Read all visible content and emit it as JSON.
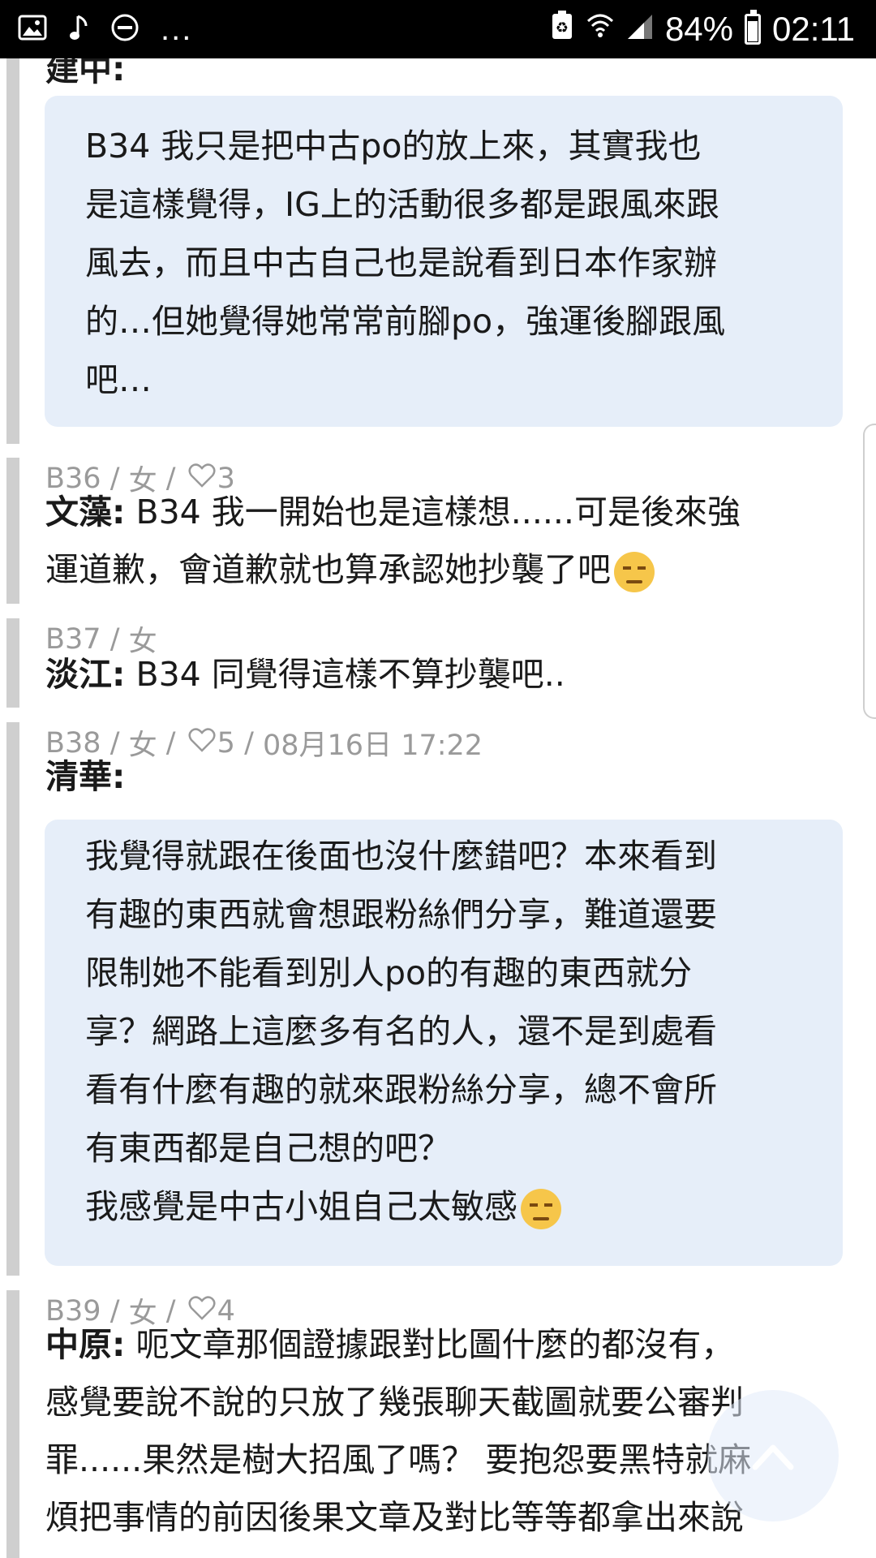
{
  "status_bar": {
    "left_icons": [
      "image-icon",
      "music-note-icon",
      "do-not-disturb-icon"
    ],
    "overflow": "...",
    "battery_percent": "84%",
    "time": "02:11"
  },
  "thread": {
    "c1": {
      "author_partial": "建中:",
      "quote_lines": [
        "B34 我只是把中古po的放上來，其實我也",
        "是這樣覺得，IG上的活動很多都是跟風來跟",
        "風去，而且中古自己也是說看到日本作家辦",
        "的…但她覺得她常常前腳po，強運後腳跟風",
        "吧…"
      ]
    },
    "c2": {
      "floor": "B36",
      "gender": "女",
      "likes": "3",
      "author": "文藻:",
      "line1": " B34 我一開始也是這樣想......可是後來強",
      "line2": "運道歉，會道歉就也算承認她抄襲了吧"
    },
    "c3": {
      "floor": "B37",
      "gender": "女",
      "author": "淡江:",
      "text": " B34 同覺得這樣不算抄襲吧.."
    },
    "c4": {
      "floor": "B38",
      "gender": "女",
      "likes": "5",
      "date": "08月16日 17:22",
      "author": "清華:",
      "quote_lines": [
        "我覺得就跟在後面也沒什麼錯吧？本來看到",
        "有趣的東西就會想跟粉絲們分享，難道還要",
        "限制她不能看到別人po的有趣的東西就分",
        "享？網路上這麼多有名的人，還不是到處看",
        "看有什麼有趣的就來跟粉絲分享，總不會所",
        "有東西都是自己想的吧？",
        "我感覺是中古小姐自己太敏感"
      ]
    },
    "c5": {
      "floor": "B39",
      "gender": "女",
      "likes": "4",
      "author": "中原:",
      "line1": " 呃文章那個證據跟對比圖什麼的都沒有，",
      "line2": "感覺要說不說的只放了幾張聊天截圖就要公審判",
      "line3": "罪......果然是樹大招風了嗎？ 要抱怨要黑特就麻",
      "line4": "煩把事情的前因後果文章及對比等等都拿出來說"
    }
  },
  "sep": " / ",
  "fab_icon": "arrow-up-icon"
}
